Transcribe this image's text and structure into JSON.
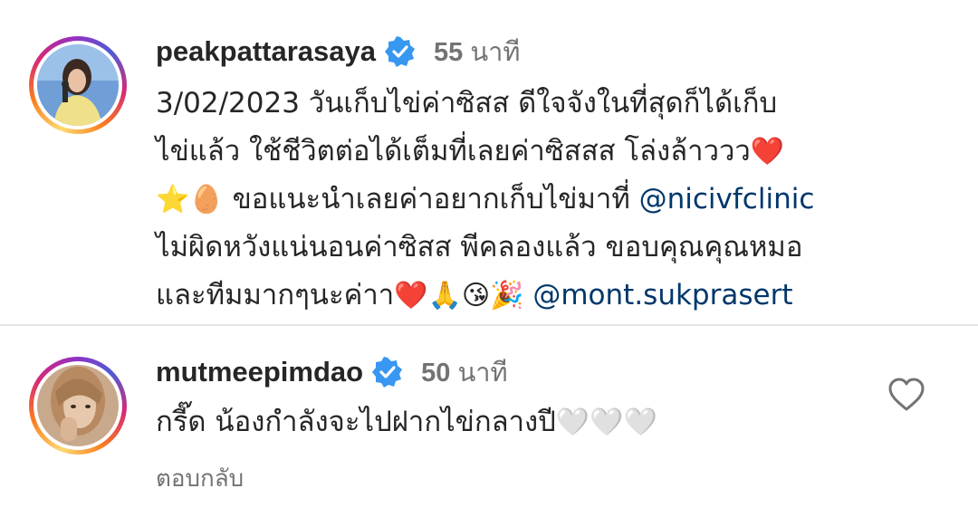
{
  "comments": [
    {
      "username": "peakpattarasaya",
      "time_num": "55",
      "time_unit": "นาที",
      "lines": [
        [
          {
            "t": "3/02/2023 วันเก็บไข่ค่าซิสส ดีใจจังในที่สุดก็ได้เก็บ"
          }
        ],
        [
          {
            "t": "ไข่แล้ว ใช้ชีวิตต่อได้เต็มที่เลยค่าซิสสส โล่งล้าววว"
          },
          {
            "t": "❤️",
            "k": "emoji"
          }
        ],
        [
          {
            "t": "⭐️🥚",
            "k": "emoji"
          },
          {
            "t": " ขอแนะนำเลยค่าอยากเก็บไข่มาที่ "
          },
          {
            "t": "@nicivfclinic",
            "k": "mention"
          }
        ],
        [
          {
            "t": "ไม่ผิดหวังแน่นอนค่าซิสส พีคลองแล้ว ขอบคุณคุณหมอ"
          }
        ],
        [
          {
            "t": "และทีมมากๆนะค่าา"
          },
          {
            "t": "❤️🙏😘🎉",
            "k": "emoji"
          },
          {
            "t": " "
          },
          {
            "t": "@mont.sukprasert",
            "k": "mention"
          }
        ]
      ]
    },
    {
      "username": "mutmeepimdao",
      "time_num": "50",
      "time_unit": "นาที",
      "lines": [
        [
          {
            "t": "กรี๊ด น้องกำลังจะไปฝากไข่กลางปี"
          },
          {
            "t": "🤍🤍🤍",
            "k": "emoji"
          }
        ]
      ],
      "reply_label": "ตอบกลับ"
    }
  ],
  "colors": {
    "text": "#262626",
    "secondary": "#737373",
    "mention": "#00376b",
    "verified": "#3897f0"
  },
  "icons": [
    "verified-badge-icon",
    "heart-outline-icon"
  ]
}
